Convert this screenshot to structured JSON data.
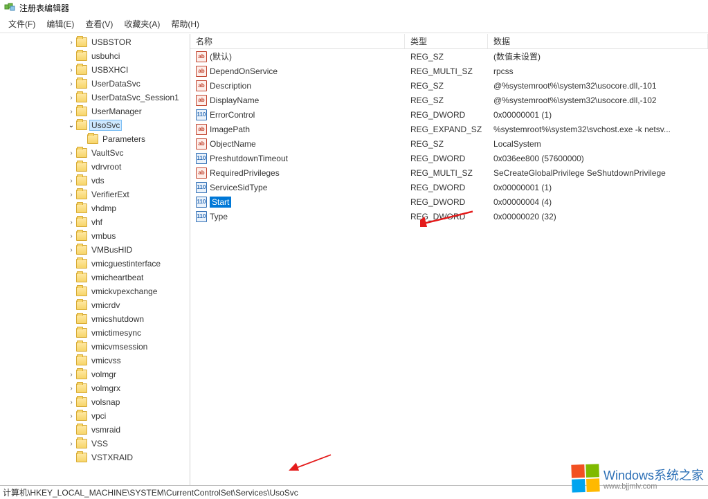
{
  "window": {
    "title": "注册表编辑器"
  },
  "menu": {
    "file": "文件(F)",
    "edit": "编辑(E)",
    "view": "查看(V)",
    "favorites": "收藏夹(A)",
    "help": "帮助(H)"
  },
  "tree": {
    "selected": "UsoSvc",
    "items": [
      {
        "d": 6,
        "c": ">",
        "l": "USBSTOR"
      },
      {
        "d": 6,
        "c": "",
        "l": "usbuhci"
      },
      {
        "d": 6,
        "c": ">",
        "l": "USBXHCI"
      },
      {
        "d": 6,
        "c": ">",
        "l": "UserDataSvc"
      },
      {
        "d": 6,
        "c": ">",
        "l": "UserDataSvc_Session1"
      },
      {
        "d": 6,
        "c": ">",
        "l": "UserManager"
      },
      {
        "d": 6,
        "c": "v",
        "l": "UsoSvc",
        "sel": true
      },
      {
        "d": 7,
        "c": "",
        "l": "Parameters"
      },
      {
        "d": 6,
        "c": ">",
        "l": "VaultSvc"
      },
      {
        "d": 6,
        "c": "",
        "l": "vdrvroot"
      },
      {
        "d": 6,
        "c": ">",
        "l": "vds"
      },
      {
        "d": 6,
        "c": ">",
        "l": "VerifierExt"
      },
      {
        "d": 6,
        "c": "",
        "l": "vhdmp"
      },
      {
        "d": 6,
        "c": ">",
        "l": "vhf"
      },
      {
        "d": 6,
        "c": ">",
        "l": "vmbus"
      },
      {
        "d": 6,
        "c": ">",
        "l": "VMBusHID"
      },
      {
        "d": 6,
        "c": "",
        "l": "vmicguestinterface"
      },
      {
        "d": 6,
        "c": "",
        "l": "vmicheartbeat"
      },
      {
        "d": 6,
        "c": "",
        "l": "vmickvpexchange"
      },
      {
        "d": 6,
        "c": "",
        "l": "vmicrdv"
      },
      {
        "d": 6,
        "c": "",
        "l": "vmicshutdown"
      },
      {
        "d": 6,
        "c": "",
        "l": "vmictimesync"
      },
      {
        "d": 6,
        "c": "",
        "l": "vmicvmsession"
      },
      {
        "d": 6,
        "c": "",
        "l": "vmicvss"
      },
      {
        "d": 6,
        "c": ">",
        "l": "volmgr"
      },
      {
        "d": 6,
        "c": ">",
        "l": "volmgrx"
      },
      {
        "d": 6,
        "c": ">",
        "l": "volsnap"
      },
      {
        "d": 6,
        "c": ">",
        "l": "vpci"
      },
      {
        "d": 6,
        "c": "",
        "l": "vsmraid"
      },
      {
        "d": 6,
        "c": ">",
        "l": "VSS"
      },
      {
        "d": 6,
        "c": "",
        "l": "VSTXRAID"
      }
    ]
  },
  "list": {
    "headers": {
      "name": "名称",
      "type": "类型",
      "data": "数据"
    },
    "rows": [
      {
        "icon": "str",
        "name": "(默认)",
        "type": "REG_SZ",
        "data": "(数值未设置)"
      },
      {
        "icon": "str",
        "name": "DependOnService",
        "type": "REG_MULTI_SZ",
        "data": "rpcss"
      },
      {
        "icon": "str",
        "name": "Description",
        "type": "REG_SZ",
        "data": "@%systemroot%\\system32\\usocore.dll,-101"
      },
      {
        "icon": "str",
        "name": "DisplayName",
        "type": "REG_SZ",
        "data": "@%systemroot%\\system32\\usocore.dll,-102"
      },
      {
        "icon": "bin",
        "name": "ErrorControl",
        "type": "REG_DWORD",
        "data": "0x00000001 (1)"
      },
      {
        "icon": "str",
        "name": "ImagePath",
        "type": "REG_EXPAND_SZ",
        "data": "%systemroot%\\system32\\svchost.exe -k netsv..."
      },
      {
        "icon": "str",
        "name": "ObjectName",
        "type": "REG_SZ",
        "data": "LocalSystem"
      },
      {
        "icon": "bin",
        "name": "PreshutdownTimeout",
        "type": "REG_DWORD",
        "data": "0x036ee800 (57600000)"
      },
      {
        "icon": "str",
        "name": "RequiredPrivileges",
        "type": "REG_MULTI_SZ",
        "data": "SeCreateGlobalPrivilege SeShutdownPrivilege"
      },
      {
        "icon": "bin",
        "name": "ServiceSidType",
        "type": "REG_DWORD",
        "data": "0x00000001 (1)"
      },
      {
        "icon": "bin",
        "name": "Start",
        "type": "REG_DWORD",
        "data": "0x00000004 (4)",
        "sel": true
      },
      {
        "icon": "bin",
        "name": "Type",
        "type": "REG_DWORD",
        "data": "0x00000020 (32)"
      }
    ]
  },
  "status": {
    "path": "计算机\\HKEY_LOCAL_MACHINE\\SYSTEM\\CurrentControlSet\\Services\\UsoSvc"
  },
  "watermark": {
    "line1": "Windows系统之家",
    "line2": "www.bjjmlv.com"
  }
}
